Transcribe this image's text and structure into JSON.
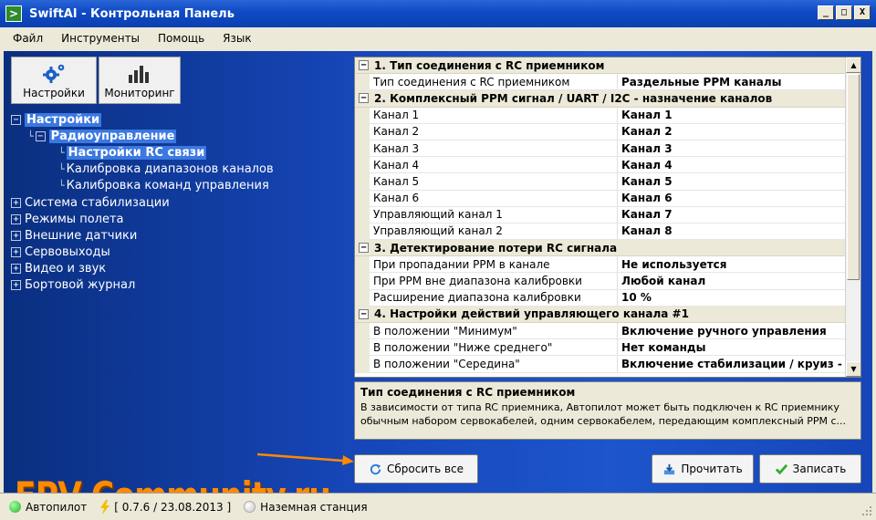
{
  "window": {
    "title": "SwiftAI - Контрольная Панель",
    "controls": [
      "_",
      "□",
      "X"
    ]
  },
  "menu": [
    "Файл",
    "Инструменты",
    "Помощь",
    "Язык"
  ],
  "toolbar": {
    "settings_label": "Настройки",
    "monitoring_label": "Мониторинг"
  },
  "tree": [
    {
      "label": "Настройки",
      "level": 0,
      "toggle": "−",
      "state": "sel"
    },
    {
      "label": "Радиоуправление",
      "level": 1,
      "toggle": "−",
      "state": "sel"
    },
    {
      "label": "Настройки RC связи",
      "level": 2,
      "toggle": "",
      "state": "sel"
    },
    {
      "label": "Калибровка диапазонов каналов",
      "level": 2,
      "toggle": "",
      "state": ""
    },
    {
      "label": "Калибровка команд управления",
      "level": 2,
      "toggle": "",
      "state": ""
    },
    {
      "label": "Система стабилизации",
      "level": 0,
      "toggle": "+",
      "state": ""
    },
    {
      "label": "Режимы полета",
      "level": 0,
      "toggle": "+",
      "state": ""
    },
    {
      "label": "Внешние датчики",
      "level": 0,
      "toggle": "+",
      "state": ""
    },
    {
      "label": "Сервовыходы",
      "level": 0,
      "toggle": "+",
      "state": ""
    },
    {
      "label": "Видео и звук",
      "level": 0,
      "toggle": "+",
      "state": ""
    },
    {
      "label": "Бортовой журнал",
      "level": 0,
      "toggle": "+",
      "state": ""
    }
  ],
  "grid": [
    {
      "category": "1. Тип соединения с RC приемником"
    },
    {
      "name": "Тип соединения с RC приемником",
      "value": "Раздельные PPM каналы"
    },
    {
      "category": "2. Комплексный PPM сигнал / UART / I2C - назначение каналов"
    },
    {
      "name": "Канал 1",
      "value": "Канал 1"
    },
    {
      "name": "Канал 2",
      "value": "Канал 2"
    },
    {
      "name": "Канал 3",
      "value": "Канал 3"
    },
    {
      "name": "Канал 4",
      "value": "Канал 4"
    },
    {
      "name": "Канал 5",
      "value": "Канал 5"
    },
    {
      "name": "Канал 6",
      "value": "Канал 6"
    },
    {
      "name": "Управляющий канал 1",
      "value": "Канал 7"
    },
    {
      "name": "Управляющий канал 2",
      "value": "Канал 8"
    },
    {
      "category": "3. Детектирование потери RC сигнала"
    },
    {
      "name": "При пропадании PPM в канале",
      "value": "Не используется"
    },
    {
      "name": "При PPM вне диапазона калибровки",
      "value": "Любой канал"
    },
    {
      "name": "Расширение диапазона калибровки",
      "value": "10 %"
    },
    {
      "category": "4. Настройки действий управляющего канала #1"
    },
    {
      "name": "В положении \"Минимум\"",
      "value": "Включение ручного управления"
    },
    {
      "name": "В положении \"Ниже среднего\"",
      "value": "Нет команды"
    },
    {
      "name": "В положении \"Середина\"",
      "value": "Включение стабилизации / круиз - к"
    }
  ],
  "description": {
    "title": "Тип соединения с RC приемником",
    "text": "В зависимости от типа RC приемника, Автопилот может быть подключен к RC приемнику обычным набором сервокабелей, одним сервокабелем, передающим комплексный PPM с..."
  },
  "buttons": {
    "reset": "Сбросить все",
    "read": "Прочитать",
    "write": "Записать"
  },
  "watermark": "FPV-Community.ru",
  "status": {
    "autopilot": "Автопилот",
    "version": "[ 0.7.6 / 23.08.2013 ]",
    "ground": "Наземная станция"
  },
  "colors": {
    "panel_blue": "#1646b8",
    "watermark": "#ff8a00",
    "status_ok": "#2eae2e"
  }
}
